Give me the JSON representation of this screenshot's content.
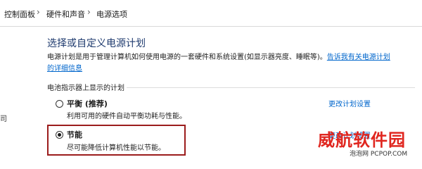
{
  "breadcrumb": {
    "items": [
      "控制面板",
      "硬件和声音",
      "电源选项"
    ],
    "separator": "›"
  },
  "left_edge_text": "司",
  "main": {
    "title": "选择或自定义电源计划",
    "description": "电源计划是用于管理计算机如何使用电源的一套硬件和系统设置(如显示器亮度、睡眠等)。",
    "description_link": "告诉我有关电源计划的详细信息",
    "group_header": "电池指示器上显示的计划"
  },
  "plans": [
    {
      "name": "平衡 (推荐)",
      "description": "利用可用的硬件自动平衡功耗与性能。",
      "change_link": "更改计划设置",
      "selected": false
    },
    {
      "name": "节能",
      "description": "尽可能降低计算机性能以节能。",
      "change_link": "更改计划设置",
      "selected": true
    }
  ],
  "watermark": {
    "brand": "威航软件园",
    "sub": "泡泡网 PCPOP.COM"
  },
  "colors": {
    "link": "#0066cc",
    "title": "#1e3a6e",
    "highlight_border": "#9b1c1c",
    "watermark": "#e0261f"
  }
}
